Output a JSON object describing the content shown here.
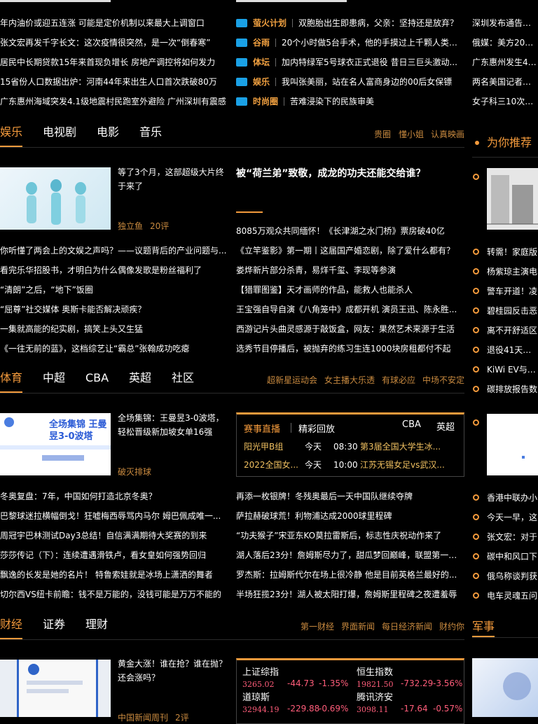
{
  "colors": {
    "accent": "#f39a3c",
    "down": "#ff5d7a"
  },
  "top": {
    "left_lines": [
      "年内油价或迎五连涨 可能是定价机制以来最大上调窗口",
      "张文宏再发千字长文：这次疫情很突然，是一次“倒春寒”",
      "居民中长期贷款15年来首现负增长 房地产调控将如何发力",
      "15省份人口数据出炉：河南44年来出生人口首次跌破80万",
      "广东惠州海域突发4.1级地震村民跑室外避险 广州深圳有震感"
    ],
    "mid_lines": [
      {
        "cat": "萤火计划",
        "text": "双胞胎出生即患病，父亲：坚持还是放弃？"
      },
      {
        "cat": "谷雨",
        "text": "20个小时做5台手术，他的手摸过上千颗人类的肺"
      },
      {
        "cat": "体坛",
        "text": "加内特绿军5号球衣正式退役 昔日三巨头激动..."
      },
      {
        "cat": "娱乐",
        "text": "我叫张美丽，站在名人富商身边的00后女保镖"
      },
      {
        "cat": "时尚圈",
        "text": "苦难浸染下的民族审美"
      }
    ],
    "right_lines": [
      "深圳发布通告：全",
      "俄媒：美方2005年",
      "广东惠州发生4.1级",
      "两名美国记者在基",
      "女子科三10次未过"
    ]
  },
  "ent": {
    "tabs": [
      "娱乐",
      "电视剧",
      "电影",
      "音乐"
    ],
    "sublinks": [
      "贵圈",
      "懂小姐",
      "认真映画"
    ],
    "feature": {
      "title": "等了3个月，这部超级大片终于来了",
      "source": "独立鱼",
      "comments": "20评"
    },
    "headline": "被“荷兰弟”致敬，成龙的功夫还能交给谁？",
    "left_list": [
      "你听懂了两会上的文娱之声吗？——议题背后的产业问题与...",
      "看完乐华招股书，才明白为什么偶像发歌是粉丝福利了",
      "“清朗”之后，“地下”饭圈",
      "“屈尊”社交媒体 奥斯卡能否解决顽疾？",
      "一集就高能的纪实剧，搞笑上头又生猛",
      "《一往无前的蓝》，这档综艺让“霸总”张翰成功吃瘪"
    ],
    "right_list": [
      "8085万观众共同缅怀！《长津湖之水门桥》票房破40亿",
      "《立竿鉴影》第一期丨这届国产婚恋剧，除了爱什么都有？",
      "娄烨新片部分杀青，易烊千玺、李现等参演",
      "【猎罪图鉴】天才画师的作品，能救人也能杀人",
      "王宝强自导自演《八角笼中》成都开机 演员王迅、陈永胜...",
      "西游记片头曲灵感源于敲饭盒，网友：果然艺术来源于生活",
      "选秀节目停播后，被抛弃的练习生连1000块房租都付不起"
    ]
  },
  "sports": {
    "tabs": [
      "体育",
      "中超",
      "CBA",
      "英超",
      "社区"
    ],
    "sublinks": [
      "超新星运动会",
      "女主播大乐透",
      "有球必应",
      "中场不安定"
    ],
    "feature": {
      "title": "全场集锦：王曼昱3-0波塔，轻松晋级新加坡女单16强",
      "source": "破灭排球",
      "thumb_text": "全场集锦 王曼昱3-0波塔"
    },
    "live": {
      "tab_live": "赛事直播",
      "tab_replay": "精彩回放",
      "right_tabs": [
        "CBA",
        "英超"
      ],
      "rows": [
        {
          "league": "阳光甲B组",
          "day": "今天",
          "time": "08:30",
          "match": "第3届全国大学生冰..."
        },
        {
          "league": "2022全国女...",
          "day": "今天",
          "time": "10:00",
          "match": "江苏无锡女足vs武汉..."
        }
      ]
    },
    "left_list": [
      "冬奥复盘：7年，中国如何打造北京冬奥？",
      "巴黎球迷拉横幅倒戈！狂嘘梅西辱骂内马尔 姆巴佩成唯一...",
      "周冠宇巴林测试Day3总结！自信满满期待大奖赛的到来",
      "莎莎传记（下）：连续遭遇滑铁卢，看女皇如何强势回归",
      "飘逸的长发是她的名片！ 特鲁索娃就是冰场上潇洒的舞者",
      "切尔西VS纽卡前瞻：钱不是万能的，没钱可能是万万不能的"
    ],
    "right_list": [
      "再添一枚银牌！冬残奥最后一天中国队继续夺牌",
      "萨拉赫破球荒！利物浦达成2000球里程碑",
      "“功夫猴子”宋亚东KO莫拉雷斯后，标志性庆祝动作来了",
      "湖人落后23分！詹姆斯尽力了，甜瓜梦回巅峰，联盟第一太狠",
      "罗杰斯：拉姆斯代尔在场上很冷静 他是目前英格兰最好的...",
      "半场狂揽23分！湖人被太阳打爆，詹姆斯里程碑之夜遭羞辱"
    ]
  },
  "finance": {
    "tabs": [
      "财经",
      "证券",
      "理财"
    ],
    "sublinks": [
      "第一财经",
      "界面新闻",
      "每日经济新闻",
      "财约你"
    ],
    "feature": {
      "title": "黄金大涨！谁在抢？谁在抛？还会涨吗？",
      "source": "中国新闻周刊",
      "comments": "2评"
    },
    "stocks": [
      {
        "name": "上证综指",
        "value": "3265.02",
        "change": "-44.73",
        "pct": "-1.35%"
      },
      {
        "name": "恒生指数",
        "value": "19821.50",
        "change": "-732.29",
        "pct": "-3.56%"
      },
      {
        "name": "道琼斯",
        "value": "32944.19",
        "change": "-229.88",
        "pct": "-0.69%"
      },
      {
        "name": "腾讯济安",
        "value": "3098.11",
        "change": "-17.64",
        "pct": "-0.57%"
      }
    ]
  },
  "right_col": {
    "recommend_title": "为你推荐",
    "items_a": [
      "转需！家庭版",
      "杨紫琼主演电",
      "警车开道！凌",
      "碧桂园反击恶",
      "离不开舒适区",
      "退役41天后复",
      "KiWi EV与草莓",
      "碳排放报告数"
    ],
    "items_b": [
      "香港中联办小",
      "今天一早，这",
      "张文宏：对于",
      "碳中和风口下",
      "俄乌称谈判获",
      "电车灵魂五问"
    ],
    "military_title": "军事"
  }
}
